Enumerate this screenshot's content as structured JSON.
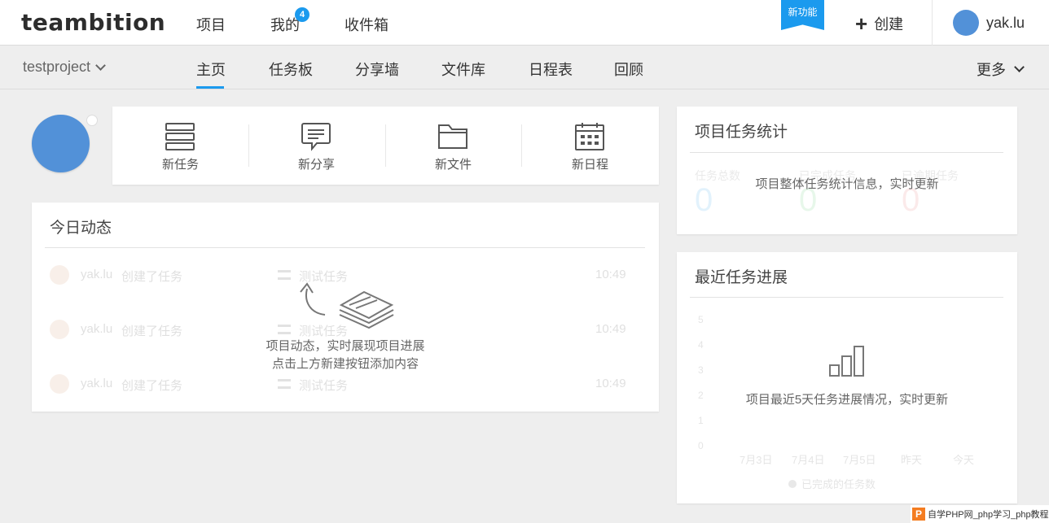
{
  "header": {
    "logo": "teambition",
    "nav": [
      "项目",
      "我的",
      "收件箱"
    ],
    "notification_count": "4",
    "ribbon": "新功能",
    "create_label": "创建",
    "user_name": "yak.lu"
  },
  "project_bar": {
    "project_name": "testproject",
    "tabs": [
      "主页",
      "任务板",
      "分享墙",
      "文件库",
      "日程表",
      "回顾"
    ],
    "active_tab": "主页",
    "more_label": "更多"
  },
  "quick_actions": [
    {
      "label": "新任务",
      "icon": "task-list-icon"
    },
    {
      "label": "新分享",
      "icon": "share-bubble-icon"
    },
    {
      "label": "新文件",
      "icon": "folder-icon"
    },
    {
      "label": "新日程",
      "icon": "calendar-icon"
    }
  ],
  "activity": {
    "title": "今日动态",
    "rows": [
      {
        "user": "yak.lu",
        "verb": "创建了任务",
        "task": "测试任务",
        "time": "10:49"
      },
      {
        "user": "yak.lu",
        "verb": "创建了任务",
        "task": "测试任务",
        "time": "10:49"
      },
      {
        "user": "yak.lu",
        "verb": "创建了任务",
        "task": "测试任务",
        "time": "10:49"
      }
    ],
    "empty_line1": "项目动态，实时展现项目进展",
    "empty_line2": "点击上方新建按钮添加内容"
  },
  "stats": {
    "title": "项目任务统计",
    "labels": [
      "任务总数",
      "已完成任务",
      "已逾期任务"
    ],
    "values": [
      "0",
      "0",
      "0"
    ],
    "colors": [
      "#1b9aee",
      "#45c15a",
      "#e65b5b"
    ],
    "overlay": "项目整体任务统计信息，实时更新"
  },
  "progress": {
    "title": "最近任务进展",
    "overlay": "项目最近5天任务进展情况，实时更新",
    "y_ticks": [
      "5",
      "4",
      "3",
      "2",
      "1",
      "0"
    ],
    "x_ticks": [
      "7月3日",
      "7月4日",
      "7月5日",
      "昨天",
      "今天"
    ],
    "legend": "已完成的任务数"
  },
  "watermark": {
    "logo": "P",
    "text": "自学PHP网_php学习_php教程"
  }
}
